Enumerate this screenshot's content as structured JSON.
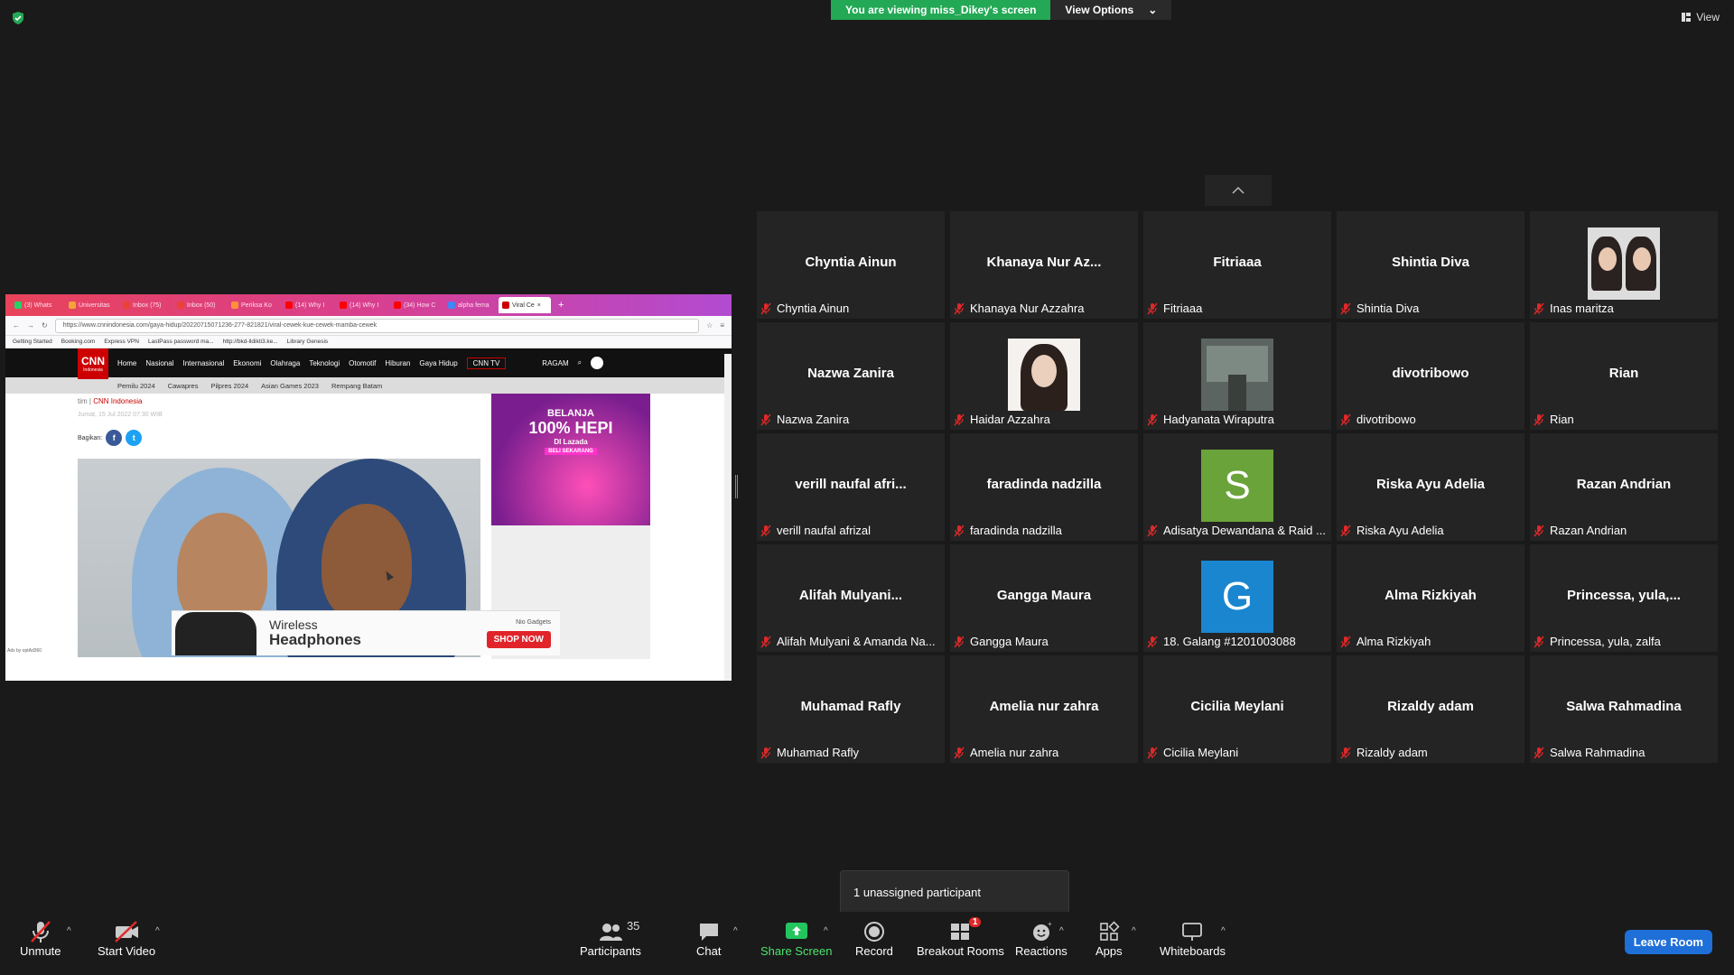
{
  "top": {
    "viewing_text": "You are viewing miss_Dikey's screen",
    "view_options_label": "View Options",
    "view_label": "View"
  },
  "shared_screen": {
    "browser": {
      "tabs": [
        "(3) Whats",
        "Universitas",
        "Inbox (75)",
        "Inbox (50)",
        "Periksa Ko",
        "(14) Why I",
        "(14) Why I",
        "(34) How C",
        "alpha fema",
        "Viral Ce"
      ],
      "url": "https://www.cnnindonesia.com/gaya-hidup/20220715071236-277-821821/viral-cewek-kue-cewek-mamba-cewek",
      "bookmarks": [
        "Getting Started",
        "Booking.com",
        "Express VPN",
        "LastPass password ma...",
        "http://bkd-lldikti3.ke...",
        "Library Genesis"
      ]
    },
    "cnn": {
      "logo": "CNN",
      "logo_sub": "Indonesia",
      "menu": [
        "Home",
        "Nasional",
        "Internasional",
        "Ekonomi",
        "Olahraga",
        "Teknologi",
        "Otomotif",
        "Hiburan",
        "Gaya Hidup"
      ],
      "tv": "CNN TV",
      "ragam": "RAGAM",
      "sub_menu": [
        "Pemilu 2024",
        "Cawapres",
        "Pilpres 2024",
        "Asian Games 2023",
        "Rempang Batam"
      ],
      "byline_prefix": "tim | ",
      "byline_source": "CNN Indonesia",
      "date": "Jumat, 15 Jul 2022 07:30 WIB",
      "share_label": "Bagikan:",
      "ad_right_line1": "BELANJA",
      "ad_right_line2": "100% HEPI",
      "ad_right_line3": "DI Lazada",
      "ad_right_cta": "BELI SEKARANG",
      "ad_bottom_title1": "Wireless",
      "ad_bottom_title2": "Headphones",
      "ad_bottom_brand": "Nio Gadgets",
      "ad_bottom_cta": "SHOP NOW",
      "ads_by": "Ads by optAd360"
    }
  },
  "participants": [
    {
      "name": "Chyntia Ainun",
      "label": "Chyntia Ainun",
      "kind": "name"
    },
    {
      "name": "Khanaya Nur Az...",
      "label": "Khanaya Nur Azzahra",
      "kind": "name"
    },
    {
      "name": "Fitriaaa",
      "label": "Fitriaaa",
      "kind": "name"
    },
    {
      "name": "Shintia Diva",
      "label": "Shintia Diva",
      "kind": "name"
    },
    {
      "name": "",
      "label": "Inas maritza",
      "kind": "photo-pair"
    },
    {
      "name": "Nazwa Zanira",
      "label": "Nazwa Zanira",
      "kind": "name"
    },
    {
      "name": "",
      "label": "Haidar Azzahra",
      "kind": "photo-girl"
    },
    {
      "name": "",
      "label": "Hadyanata Wiraputra",
      "kind": "photo-room"
    },
    {
      "name": "divotribowo",
      "label": "divotribowo",
      "kind": "name"
    },
    {
      "name": "Rian",
      "label": "Rian",
      "kind": "name"
    },
    {
      "name": "verill naufal afri...",
      "label": "verill naufal afrizal",
      "kind": "name"
    },
    {
      "name": "faradinda nadzilla",
      "label": "faradinda nadzilla",
      "kind": "name"
    },
    {
      "name": "S",
      "label": "Adisatya Dewandana & Raid ...",
      "kind": "letter",
      "color": "#6aa33a"
    },
    {
      "name": "Riska Ayu Adelia",
      "label": "Riska Ayu Adelia",
      "kind": "name"
    },
    {
      "name": "Razan Andrian",
      "label": "Razan Andrian",
      "kind": "name"
    },
    {
      "name": "Alifah  Mulyani...",
      "label": "Alifah Mulyani & Amanda Na...",
      "kind": "name"
    },
    {
      "name": "Gangga Maura",
      "label": "Gangga Maura",
      "kind": "name"
    },
    {
      "name": "G",
      "label": "18. Galang #1201003088",
      "kind": "letter",
      "color": "#1a86d0"
    },
    {
      "name": "Alma Rizkiyah",
      "label": "Alma Rizkiyah",
      "kind": "name"
    },
    {
      "name": "Princessa,  yula,...",
      "label": "Princessa, yula, zalfa",
      "kind": "name"
    },
    {
      "name": "Muhamad Rafly",
      "label": "Muhamad Rafly",
      "kind": "name"
    },
    {
      "name": "Amelia nur zahra",
      "label": "Amelia nur zahra",
      "kind": "name"
    },
    {
      "name": "Cicilia Meylani",
      "label": "Cicilia Meylani",
      "kind": "name"
    },
    {
      "name": "Rizaldy adam",
      "label": "Rizaldy adam",
      "kind": "name"
    },
    {
      "name": "Salwa Rahmadina",
      "label": "Salwa Rahmadina",
      "kind": "name"
    }
  ],
  "toast": {
    "text": "1 unassigned participant"
  },
  "toolbar": {
    "unmute": "Unmute",
    "start_video": "Start Video",
    "participants": "Participants",
    "participants_count": "35",
    "chat": "Chat",
    "share_screen": "Share Screen",
    "record": "Record",
    "breakout_rooms": "Breakout Rooms",
    "breakout_badge": "1",
    "reactions": "Reactions",
    "apps": "Apps",
    "whiteboards": "Whiteboards",
    "leave": "Leave Room"
  },
  "colors": {
    "accent_green": "#23a955",
    "leave_blue": "#1f6fd9",
    "mute_red": "#e02828"
  }
}
